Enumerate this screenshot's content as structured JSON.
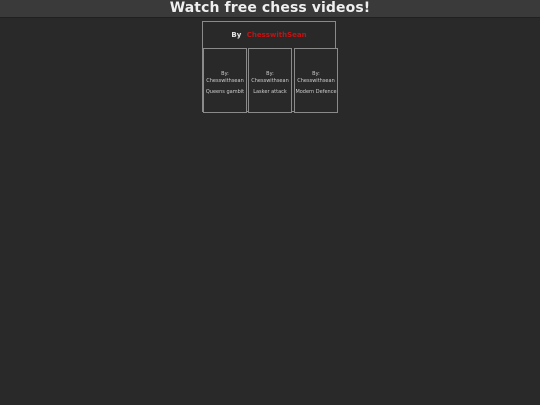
{
  "header": {
    "title": "Watch free chess videos!"
  },
  "panel": {
    "by_label": "By",
    "author": "ChesswithSean",
    "author_color": "#c41212"
  },
  "videos": [
    {
      "by_label": "By:",
      "channel": "Chesswithsean",
      "title": "Queens gambit"
    },
    {
      "by_label": "By:",
      "channel": "Chesswithsean",
      "title": "Lasker attack"
    },
    {
      "by_label": "By:",
      "channel": "Chesswithsean",
      "title": "Modern Defence"
    }
  ]
}
